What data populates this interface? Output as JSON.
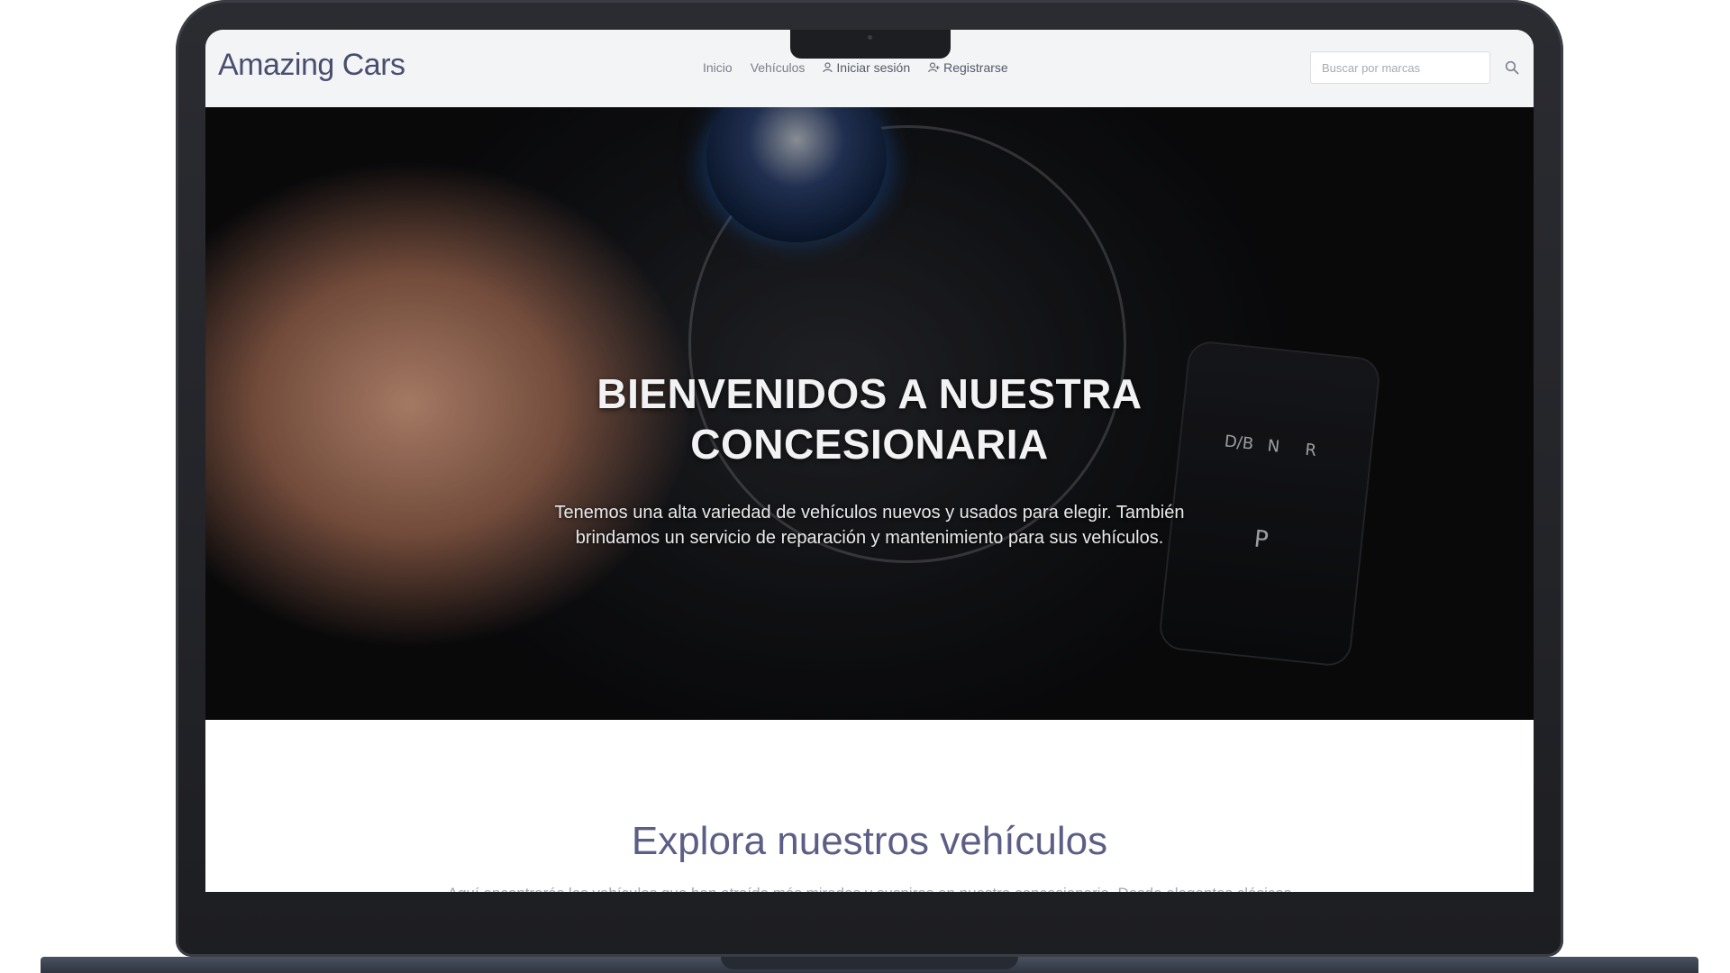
{
  "navbar": {
    "brand": "Amazing Cars",
    "links": [
      {
        "label": "Inicio"
      },
      {
        "label": "Vehículos"
      },
      {
        "label": "Iniciar sesión",
        "icon": "user-icon"
      },
      {
        "label": "Registrarse",
        "icon": "user-plus-icon"
      }
    ],
    "search": {
      "placeholder": "Buscar por marcas",
      "icon": "search-icon"
    }
  },
  "hero": {
    "title_line1": "BIENVENIDOS A NUESTRA",
    "title_line2": "CONCESIONARIA",
    "subtitle_line1": "Tenemos una alta variedad de vehículos nuevos y usados para elegir. También",
    "subtitle_line2": "brindamos un servicio de reparación y mantenimiento para sus vehículos."
  },
  "explore": {
    "title": "Explora nuestros vehículos",
    "text": "Aquí encontrarás los vehículos que han atraído más miradas y suspiros en nuestra concesionaria. Desde elegantes clásicos"
  },
  "colors": {
    "brand": "#4a4e6e",
    "explore_title": "#5c5f85",
    "navbar_bg": "#f3f4f6"
  }
}
